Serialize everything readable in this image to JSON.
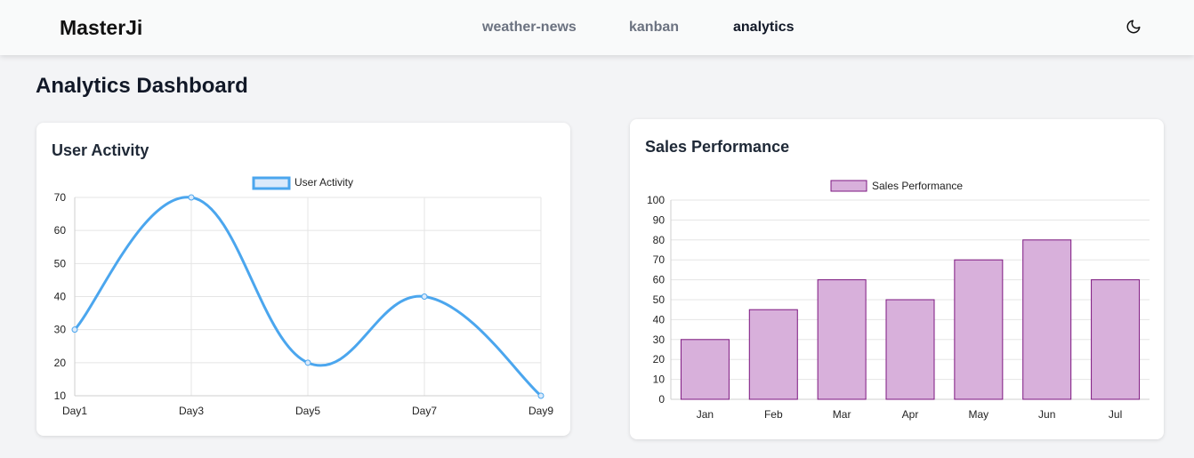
{
  "app": {
    "brand": "MasterJi"
  },
  "nav": {
    "items": [
      {
        "label": "weather-news",
        "active": false
      },
      {
        "label": "kanban",
        "active": false
      },
      {
        "label": "analytics",
        "active": true
      }
    ],
    "theme_icon": "moon-icon"
  },
  "page": {
    "title": "Analytics Dashboard"
  },
  "cards": {
    "user_activity": {
      "title": "User Activity"
    },
    "sales_performance": {
      "title": "Sales Performance"
    }
  },
  "chart_data": [
    {
      "type": "line",
      "title": "User Activity",
      "categories": [
        "Day1",
        "Day3",
        "Day5",
        "Day7",
        "Day9"
      ],
      "series": [
        {
          "name": "User Activity",
          "values": [
            30,
            70,
            20,
            40,
            10
          ],
          "color": "#4ba6ee"
        }
      ],
      "yticks": [
        10,
        20,
        30,
        40,
        50,
        60,
        70
      ],
      "ylim": [
        10,
        70
      ],
      "grid": true,
      "legend": "top-center"
    },
    {
      "type": "bar",
      "title": "Sales Performance",
      "categories": [
        "Jan",
        "Feb",
        "Mar",
        "Apr",
        "May",
        "Jun",
        "Jul"
      ],
      "series": [
        {
          "name": "Sales Performance",
          "values": [
            30,
            45,
            60,
            50,
            70,
            80,
            60
          ],
          "color": "#d8b0db",
          "border": "#7d1780"
        }
      ],
      "yticks": [
        0,
        10,
        20,
        30,
        40,
        50,
        60,
        70,
        80,
        90,
        100
      ],
      "ylim": [
        0,
        100
      ],
      "grid": true,
      "legend": "top-center"
    }
  ]
}
